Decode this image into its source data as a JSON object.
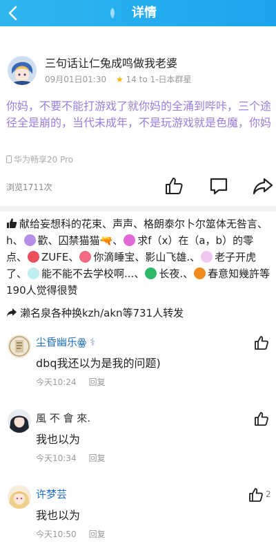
{
  "header": {
    "title": "详情",
    "back_icon": "chevron-left-icon"
  },
  "post": {
    "title": "三句话让仁兔成鸣做我老婆",
    "time": "09月01日01:30",
    "star_icon": "star-icon",
    "group": "14 to 1-日本群星",
    "body": "你妈，不要不能打游戏了就你妈的全涌到哔咔，三个途径全是崩的，当代未成年，不是玩游戏就是色魔，你妈",
    "device": "华为畅享20 Pro",
    "views": "浏览1711次"
  },
  "likes": {
    "s1": "献给妄想科的花束、声声、格朗泰尔卜尔筮体无咎言、h、",
    "s2": "歡、囚禁猫猫🔫、",
    "s3": "求f（x）在（a，b）的零点、",
    "s4": "ZUFE、",
    "s5": "你滴睡宝、影山飞雄.、",
    "s6": "老子开虎了、",
    "s7": "能不能不去学校啊...、",
    "s8": "长夜.、",
    "s9": "春意知幾許等190人觉得很赞"
  },
  "forward": {
    "text": "濑名泉各种换kzh/akn等731人转发"
  },
  "comments": [
    {
      "name": "尘昏幽乐ꙮ",
      "name_suffix": "⚕",
      "name_color": "#1c6fc2",
      "text": "dbq我还以为是我的问题)",
      "time": "今天10:24",
      "reply": "回复",
      "likes": ""
    },
    {
      "name": "風 不 會 來.",
      "name_suffix": "",
      "name_color": "#333333",
      "text": "我也以为",
      "time": "今天10:34",
      "reply": "回复",
      "likes": ""
    },
    {
      "name": "许梦芸",
      "name_suffix": "",
      "name_color": "#1c6fc2",
      "text": "我也以为",
      "time": "今天10:50",
      "reply": "回复",
      "likes": "2"
    }
  ],
  "colors": {
    "header": "#1aa5ee",
    "post_body": "#9a7ddc",
    "name_blue": "#1c6fc2"
  }
}
